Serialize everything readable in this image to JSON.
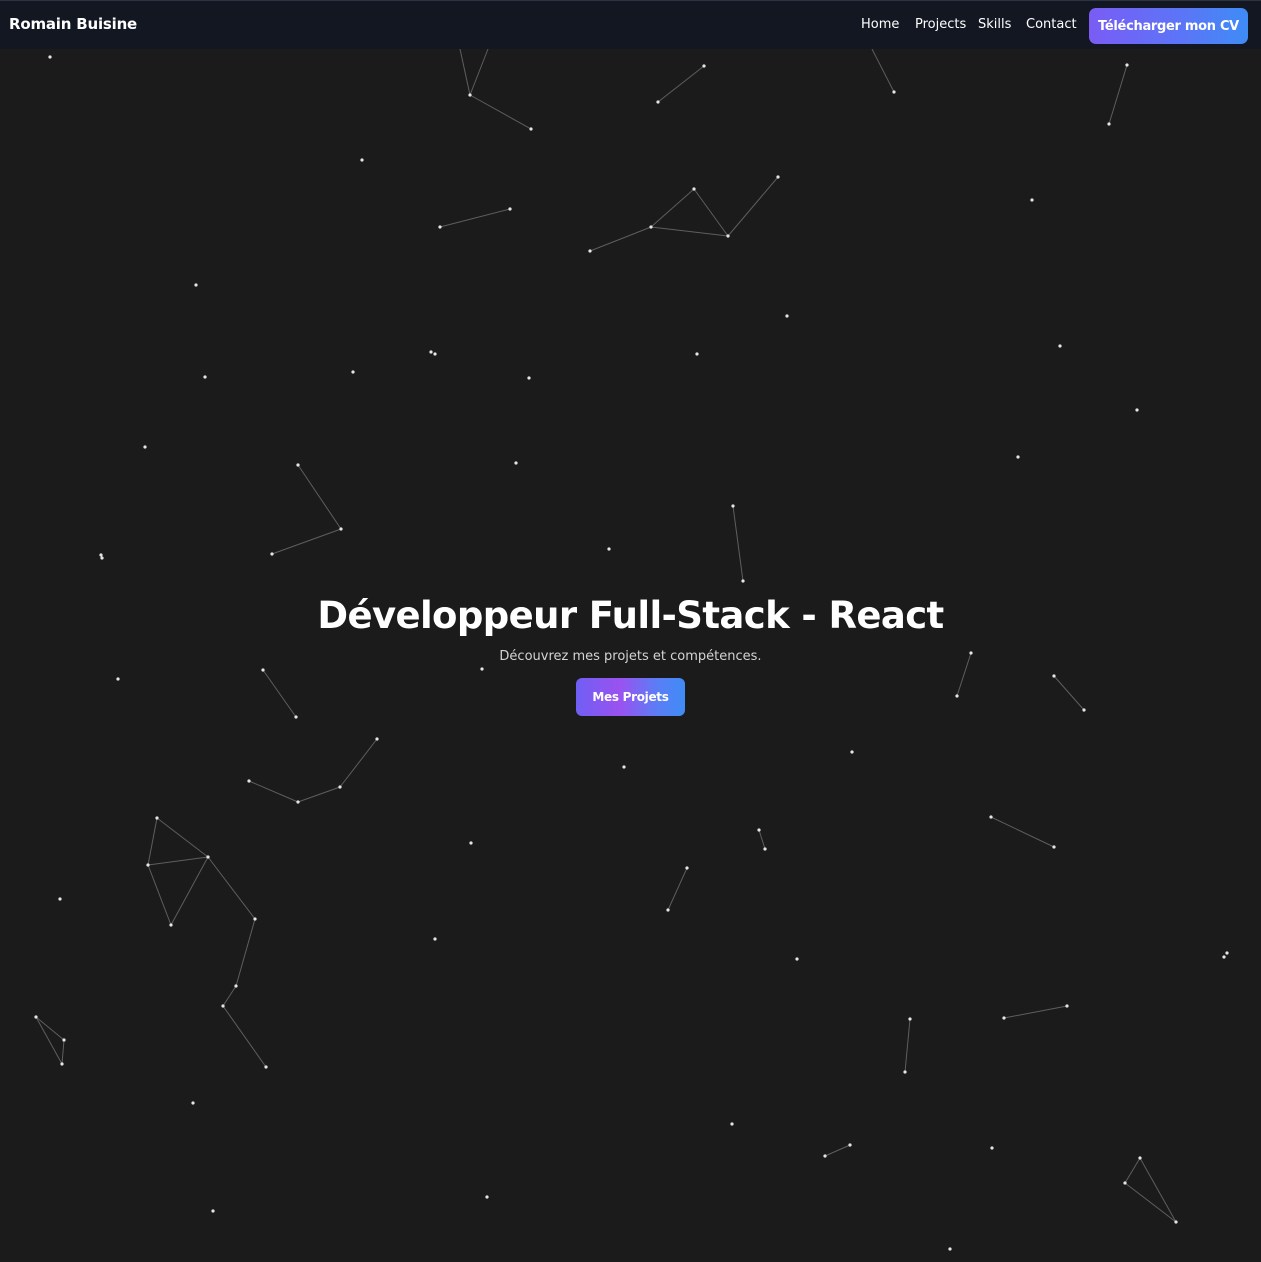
{
  "navbar": {
    "brand": "Romain Buisine",
    "links": [
      "Home",
      "Projects",
      "Skills",
      "Contact"
    ],
    "cv_button": "Télécharger mon CV"
  },
  "hero": {
    "title": "Développeur Full-Stack - React",
    "subtitle": "Découvrez mes projets et compétences.",
    "cta": "Mes Projets"
  },
  "colors": {
    "background": "#1b1b1b",
    "navbar": "#121722",
    "gradient_start": "#7a5cf5",
    "gradient_end": "#3f8cf5",
    "particle": "#e6e6e6",
    "particle_link": "#6a6a6a"
  }
}
